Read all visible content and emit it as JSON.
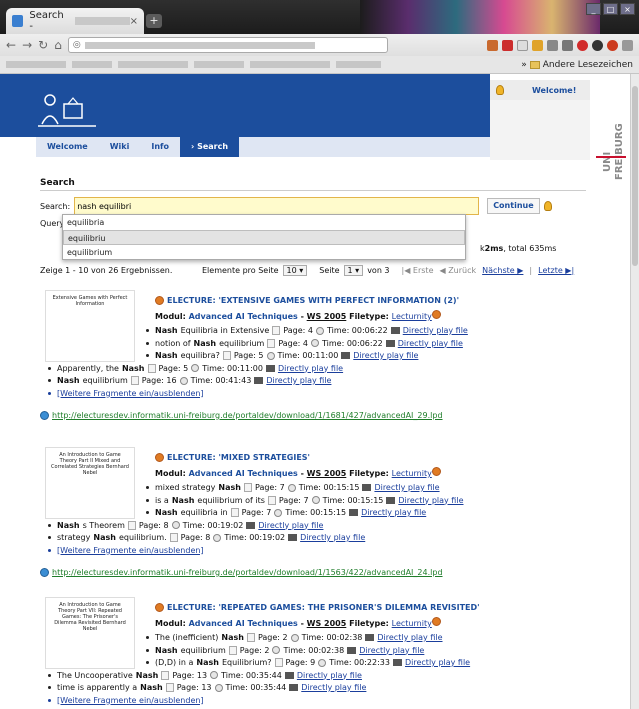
{
  "browser": {
    "tab_title": "Search -",
    "tab_close": "×",
    "new_tab": "+",
    "more": "»",
    "bookmark_folder": "Andere Lesezeichen"
  },
  "welcome": "Welcome!",
  "nav": [
    "Welcome",
    "Wiki",
    "Info",
    "› Search"
  ],
  "section_title": "Search",
  "search": {
    "label": "Search:",
    "value": "nash equilibri",
    "continue": "Continue",
    "query_label": "Query La"
  },
  "suggestions": [
    "equilibria",
    "equilibriu",
    "equilibrium"
  ],
  "timing_prefix": "k",
  "timing_bold": "2ms",
  "timing_rest": ", total 635ms",
  "pager": {
    "summary": "Zeige 1 - 10 von 26 Ergebnissen.",
    "per_page_label": "Elemente pro Seite",
    "per_page": "10",
    "page_label": "Seite",
    "page": "1",
    "of": "von 3",
    "first": "|◀ Erste",
    "prev": "◀ Zurück",
    "next": "Nächste ▶",
    "last": "Letzte ▶|"
  },
  "results": [
    {
      "title": "ELECTURE: 'EXTENSIVE GAMES WITH PERFECT INFORMATION (2)'",
      "modul": "Advanced AI Techniques",
      "ws": "WS 2005",
      "filetype": "Lecturnity",
      "thumb": "Extensive Games with Perfect Information",
      "frags": [
        {
          "pre": "",
          "b": "Nash",
          "post": " Equilibria in Extensive",
          "page": "Page: 4",
          "time": "Time: 00:06:22"
        },
        {
          "pre": "notion of ",
          "b": "Nash",
          "post": " equilibrium",
          "page": "Page: 4",
          "time": "Time: 00:06:22"
        },
        {
          "pre": "",
          "b": "Nash",
          "post": " equilibra?",
          "page": "Page: 5",
          "time": "Time: 00:11:00"
        },
        {
          "pre": "Apparently, the ",
          "b": "Nash",
          "post": "",
          "page": "Page: 5",
          "time": "Time: 00:11:00"
        },
        {
          "pre": "",
          "b": "Nash",
          "post": " equilibrium",
          "page": "Page: 16",
          "time": "Time: 00:41:43"
        }
      ],
      "more": "[Weitere Fragmente ein/ausblenden]",
      "url": "http://electuresdev.informatik.uni-freiburg.de/portaldev/download/1/1681/427/advancedAI_29.lpd"
    },
    {
      "title": "ELECTURE: 'MIXED STRATEGIES'",
      "modul": "Advanced AI Techniques",
      "ws": "WS 2005",
      "filetype": "Lecturnity",
      "thumb": "An Introduction to Game Theory Part II Mixed and Correlated Strategies Bernhard Nebel",
      "frags": [
        {
          "pre": "mixed strategy ",
          "b": "Nash",
          "post": "",
          "page": "Page: 7",
          "time": "Time: 00:15:15"
        },
        {
          "pre": "is a ",
          "b": "Nash",
          "post": " equilibrium of its",
          "page": "Page: 7",
          "time": "Time: 00:15:15"
        },
        {
          "pre": "",
          "b": "Nash",
          "post": " equilibria in",
          "page": "Page: 7",
          "time": "Time: 00:15:15"
        },
        {
          "pre": "",
          "b": "Nash",
          "post": "s Theorem",
          "page": "Page: 8",
          "time": "Time: 00:19:02"
        },
        {
          "pre": "strategy ",
          "b": "Nash",
          "post": " equilibrium.",
          "page": "Page: 8",
          "time": "Time: 00:19:02"
        }
      ],
      "more": "[Weitere Fragmente ein/ausblenden]",
      "url": "http://electuresdev.informatik.uni-freiburg.de/portaldev/download/1/1563/422/advancedAI_24.lpd"
    },
    {
      "title": "ELECTURE: 'REPEATED GAMES: THE PRISONER'S DILEMMA REVISITED'",
      "modul": "Advanced AI Techniques",
      "ws": "WS 2005",
      "filetype": "Lecturnity",
      "thumb": "An Introduction to Game Theory Part VII: Repeated Games: The Prisoner's Dilemma Revisited Bernhard Nebel",
      "frags": [
        {
          "pre": "The (inefficient) ",
          "b": "Nash",
          "post": "",
          "page": "Page: 2",
          "time": "Time: 00:02:38"
        },
        {
          "pre": "",
          "b": "Nash",
          "post": " equilibrium",
          "page": "Page: 2",
          "time": "Time: 00:02:38"
        },
        {
          "pre": "(D,D) in a ",
          "b": "Nash",
          "post": " Equilibrium?",
          "page": "Page: 9",
          "time": "Time: 00:22:33"
        },
        {
          "pre": "The Uncooperative ",
          "b": "Nash",
          "post": "",
          "page": "Page: 13",
          "time": "Time: 00:35:44"
        },
        {
          "pre": "time is apparently a ",
          "b": "Nash",
          "post": "",
          "page": "Page: 13",
          "time": "Time: 00:35:44"
        }
      ],
      "more": "[Weitere Fragmente ein/ausblenden]"
    }
  ],
  "labels": {
    "modul": "Modul:",
    "filetype": "Filetype:",
    "play": "Directly play file",
    "dash": "-"
  }
}
